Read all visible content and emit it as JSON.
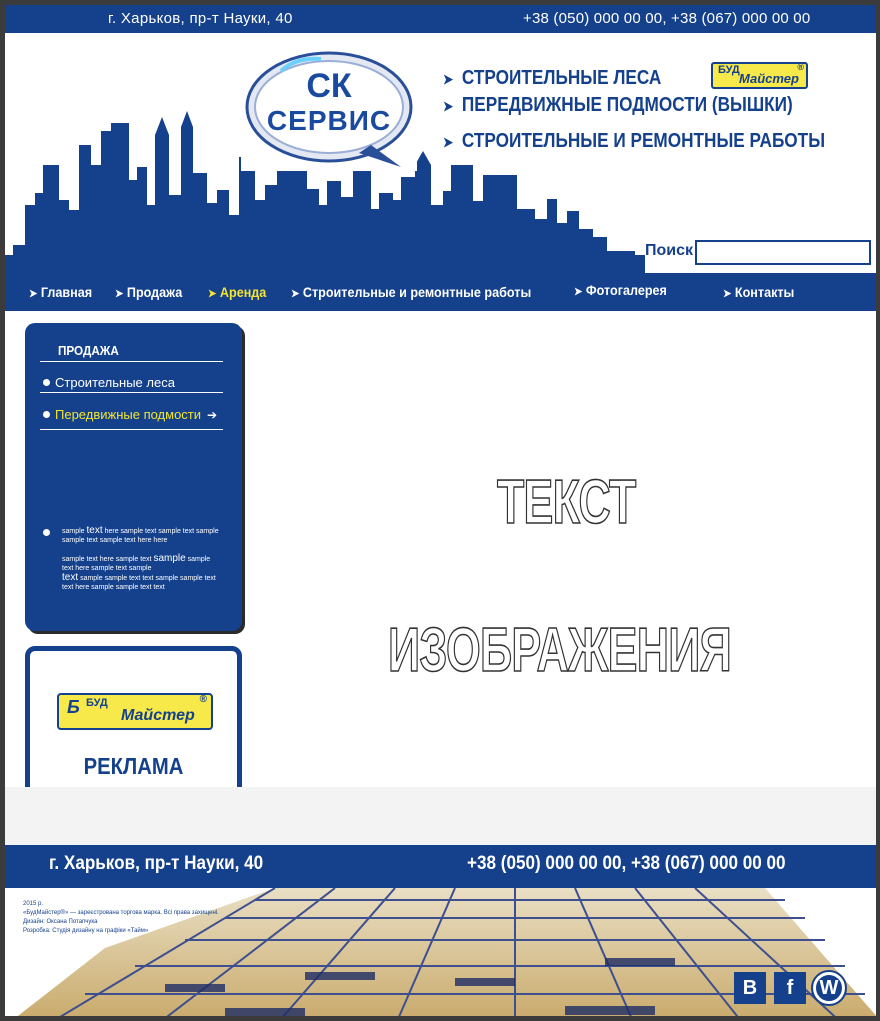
{
  "topbar": {
    "address": "г. Харьков, пр-т Науки, 40",
    "phones": "+38 (050) 000 00 00, +38 (067) 000 00 00"
  },
  "logo": {
    "line1": "СК",
    "line2": "СЕРВИС"
  },
  "services": [
    "СТРОИТЕЛЬНЫЕ ЛЕСА",
    "ПЕРЕДВИЖНЫЕ ПОДМОСТИ (ВЫШКИ)",
    "СТРОИТЕЛЬНЫЕ И РЕМОНТНЫЕ РАБОТЫ"
  ],
  "brand": {
    "part1": "БУД",
    "part2": "Майстер",
    "reg": "®"
  },
  "search": {
    "label": "Поиск",
    "value": ""
  },
  "nav": [
    "Главная",
    "Продажа",
    "Аренда",
    "Строительные и ремонтные работы",
    "Фотогалерея",
    "Контакты"
  ],
  "sidebar": {
    "title": "ПРОДАЖА",
    "items": [
      "Строительные леса",
      "Передвижные подмости"
    ],
    "sample": {
      "p1": "sample ",
      "p2": "text",
      "p3": " here sample text sample text sample sample text sample text here here",
      "p4": "sample text here sample text ",
      "p5": "sample",
      "p6": " sample text here sample text sample",
      "p7": "text",
      "p8": " sample sample text text sample sample text text here sample sample text text"
    }
  },
  "ad": {
    "label": "РЕКЛАМА"
  },
  "placeholder": {
    "line1": "ТЕКСТ",
    "line2": "ИЗОБРАЖЕНИЯ"
  },
  "footer": {
    "address": "г. Харьков, пр-т Науки, 40",
    "phones": "+38 (050) 000 00 00,   +38 (067) 000 00 00",
    "copyright_1": "2015 р.",
    "copyright_2": "«БудМайстер®» — зареєстрована торгова марка. Всі права захищені.",
    "copyright_3": "Дизайн: Оксана Потапчука",
    "copyright_4": "Розробка: Студія дизайну на графіки «Тайм»",
    "social": [
      "В",
      "f",
      "W"
    ]
  },
  "colors": {
    "primary": "#15418c",
    "accent": "#f2e530",
    "badge": "#f7e94a"
  }
}
